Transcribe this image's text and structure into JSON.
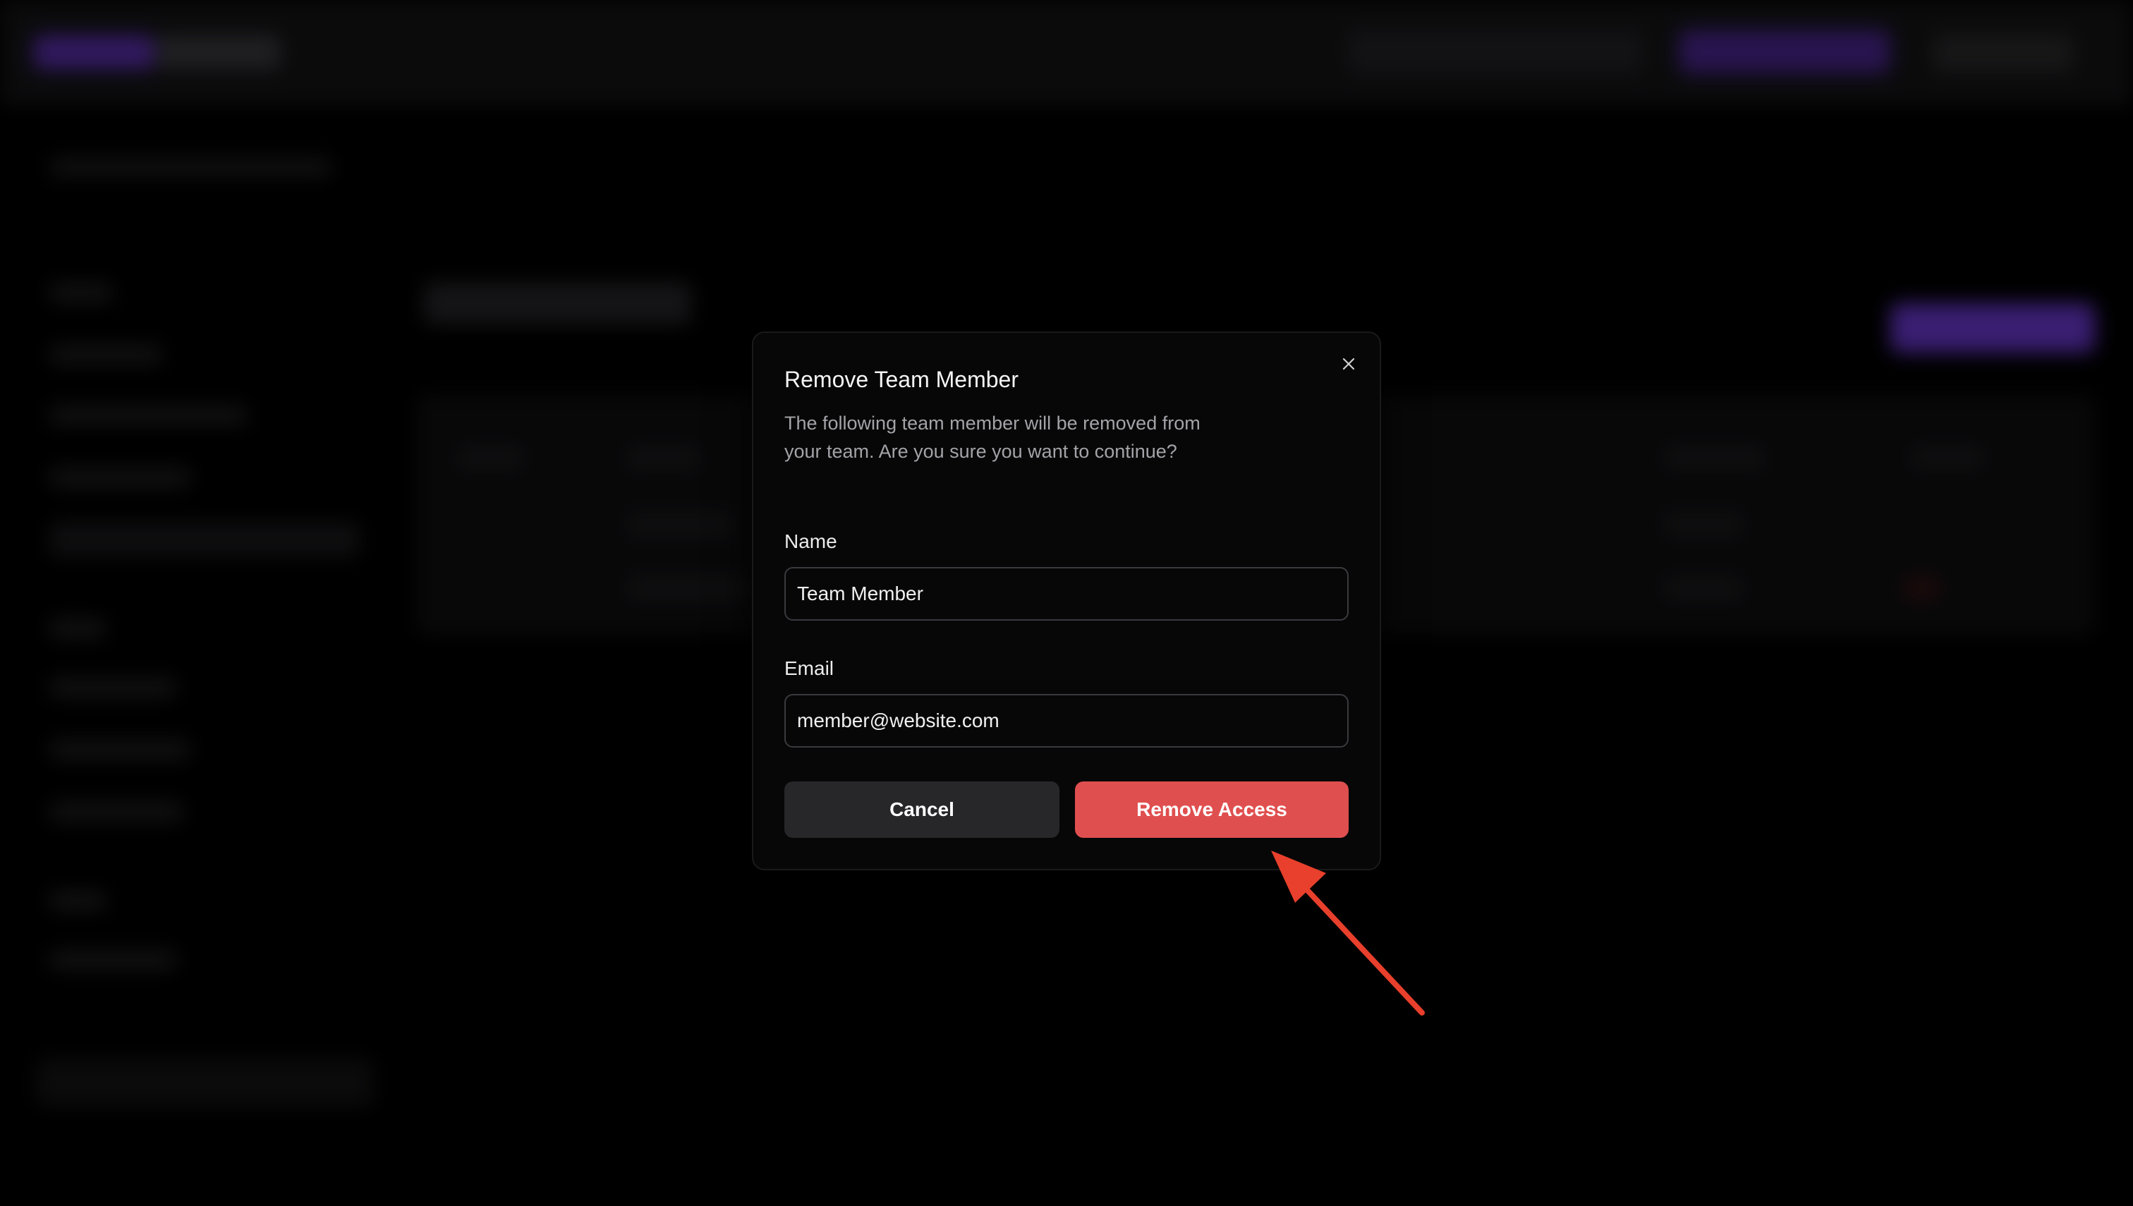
{
  "dialog": {
    "title": "Remove Team Member",
    "description": "The following team member will be removed from your team. Are you sure you want to continue?",
    "name_label": "Name",
    "name_value": "Team Member",
    "email_label": "Email",
    "email_value": "member@website.com",
    "cancel_label": "Cancel",
    "confirm_label": "Remove Access",
    "close_icon": "close-icon"
  },
  "colors": {
    "danger": "#e04f4f",
    "annotation_arrow": "#e8402c",
    "modal_bg": "#070708",
    "secondary_button": "#27272a"
  }
}
